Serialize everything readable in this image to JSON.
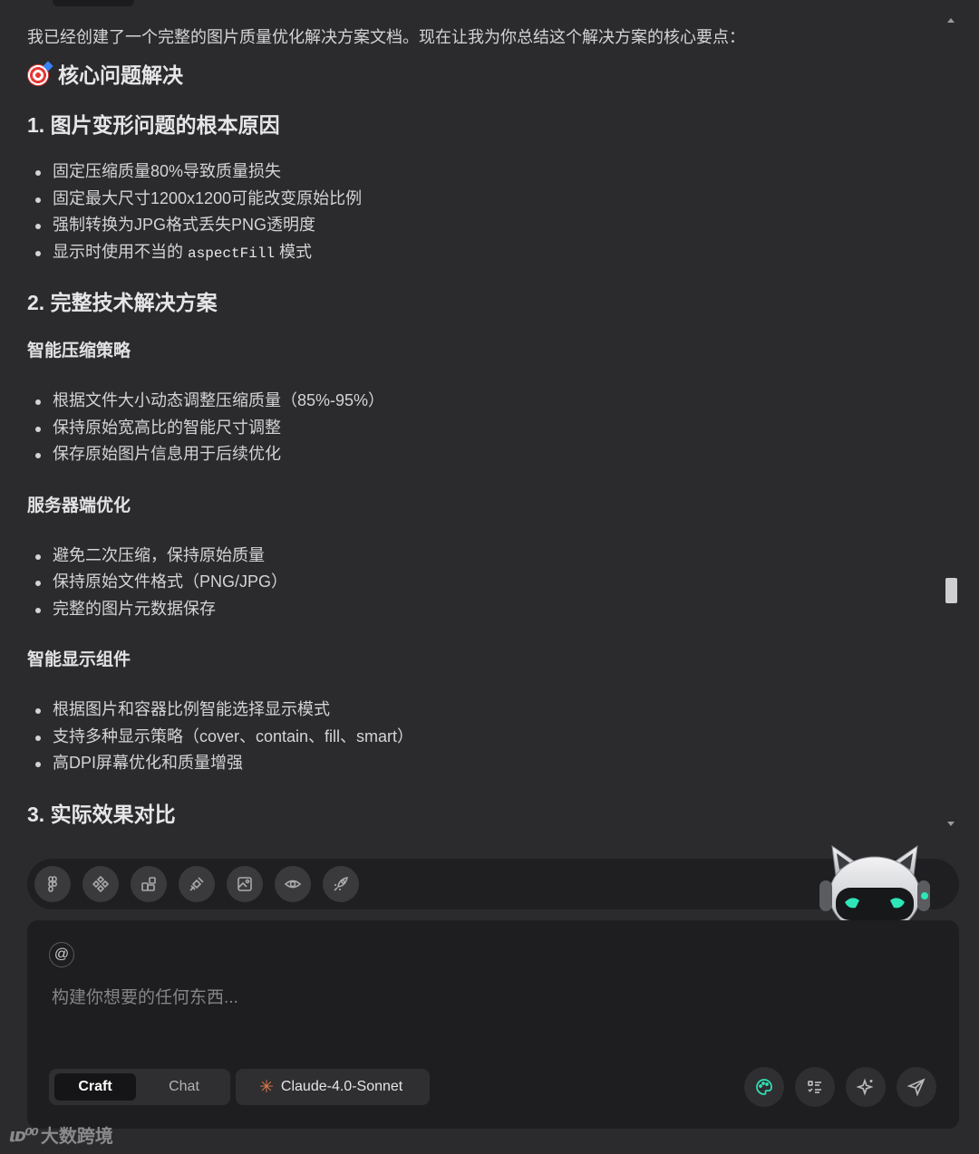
{
  "message": {
    "intro": "我已经创建了一个完整的图片质量优化解决方案文档。现在让我为你总结这个解决方案的核心要点：",
    "emoji_heading": "核心问题解决",
    "sections": [
      {
        "title": "1. 图片变形问题的根本原因",
        "items": [
          "固定压缩质量80%导致质量损失",
          "固定最大尺寸1200x1200可能改变原始比例",
          "强制转换为JPG格式丢失PNG透明度"
        ],
        "last_item_before_code": "显示时使用不当的",
        "last_item_code": "aspectFill",
        "last_item_after_code": "模式"
      },
      {
        "title": "2. 完整技术解决方案",
        "subsections": [
          {
            "title": "智能压缩策略",
            "items": [
              "根据文件大小动态调整压缩质量（85%-95%）",
              "保持原始宽高比的智能尺寸调整",
              "保存原始图片信息用于后续优化"
            ]
          },
          {
            "title": "服务器端优化",
            "items": [
              "避免二次压缩，保持原始质量",
              "保持原始文件格式（PNG/JPG）",
              "完整的图片元数据保存"
            ]
          },
          {
            "title": "智能显示组件",
            "items": [
              "根据图片和容器比例智能选择显示模式",
              "支持多种显示策略（cover、contain、fill、smart）",
              "高DPI屏幕优化和质量增强"
            ]
          }
        ]
      },
      {
        "title": "3. 实际效果对比"
      }
    ]
  },
  "toolbar": {
    "icons": [
      "figma-icon",
      "components-icon",
      "blocks-icon",
      "plug-icon",
      "image-icon",
      "eye-icon",
      "rocket-icon"
    ]
  },
  "composer": {
    "at_symbol": "@",
    "placeholder": "构建你想要的任何东西...",
    "mode_active": "Craft",
    "mode_inactive": "Chat",
    "model": "Claude-4.0-Sonnet"
  },
  "watermark": {
    "logo": "ιᴅ⁰⁰",
    "text": "大数跨境"
  },
  "colors": {
    "background": "#2b2b2d",
    "panel": "#1e1e20",
    "accent_green": "#2ee6b8",
    "model_star": "#e07a4a"
  }
}
